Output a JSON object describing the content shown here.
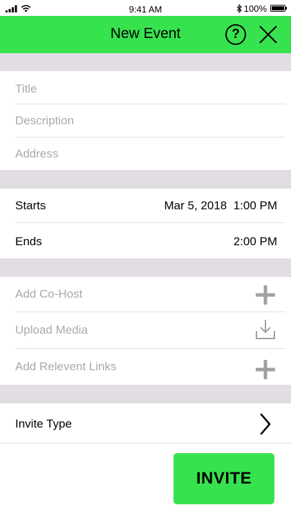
{
  "status_bar": {
    "time": "9:41 AM",
    "battery_percent": "100%",
    "battery_level": 1.0
  },
  "header": {
    "title": "New Event",
    "help_label": "?"
  },
  "fields": {
    "title_placeholder": "Title",
    "description_placeholder": "Description",
    "address_placeholder": "Address"
  },
  "schedule": {
    "starts_label": "Starts",
    "starts_value": "Mar 5, 2018  1:00 PM",
    "ends_label": "Ends",
    "ends_value": "2:00 PM"
  },
  "extras": {
    "items": [
      {
        "label": "Add Co-Host",
        "icon": "plus-icon"
      },
      {
        "label": "Upload Media",
        "icon": "download-icon"
      },
      {
        "label": "Add Relevent Links",
        "icon": "plus-icon"
      }
    ]
  },
  "invite_type": {
    "label": "Invite Type",
    "icon": "chevron-right-icon"
  },
  "actions": {
    "invite_label": "INVITE"
  },
  "colors": {
    "accent": "#37e24f",
    "separator": "#e2dde3",
    "placeholder": "#a9a9a9",
    "icon_gray": "#a0a0a0"
  }
}
